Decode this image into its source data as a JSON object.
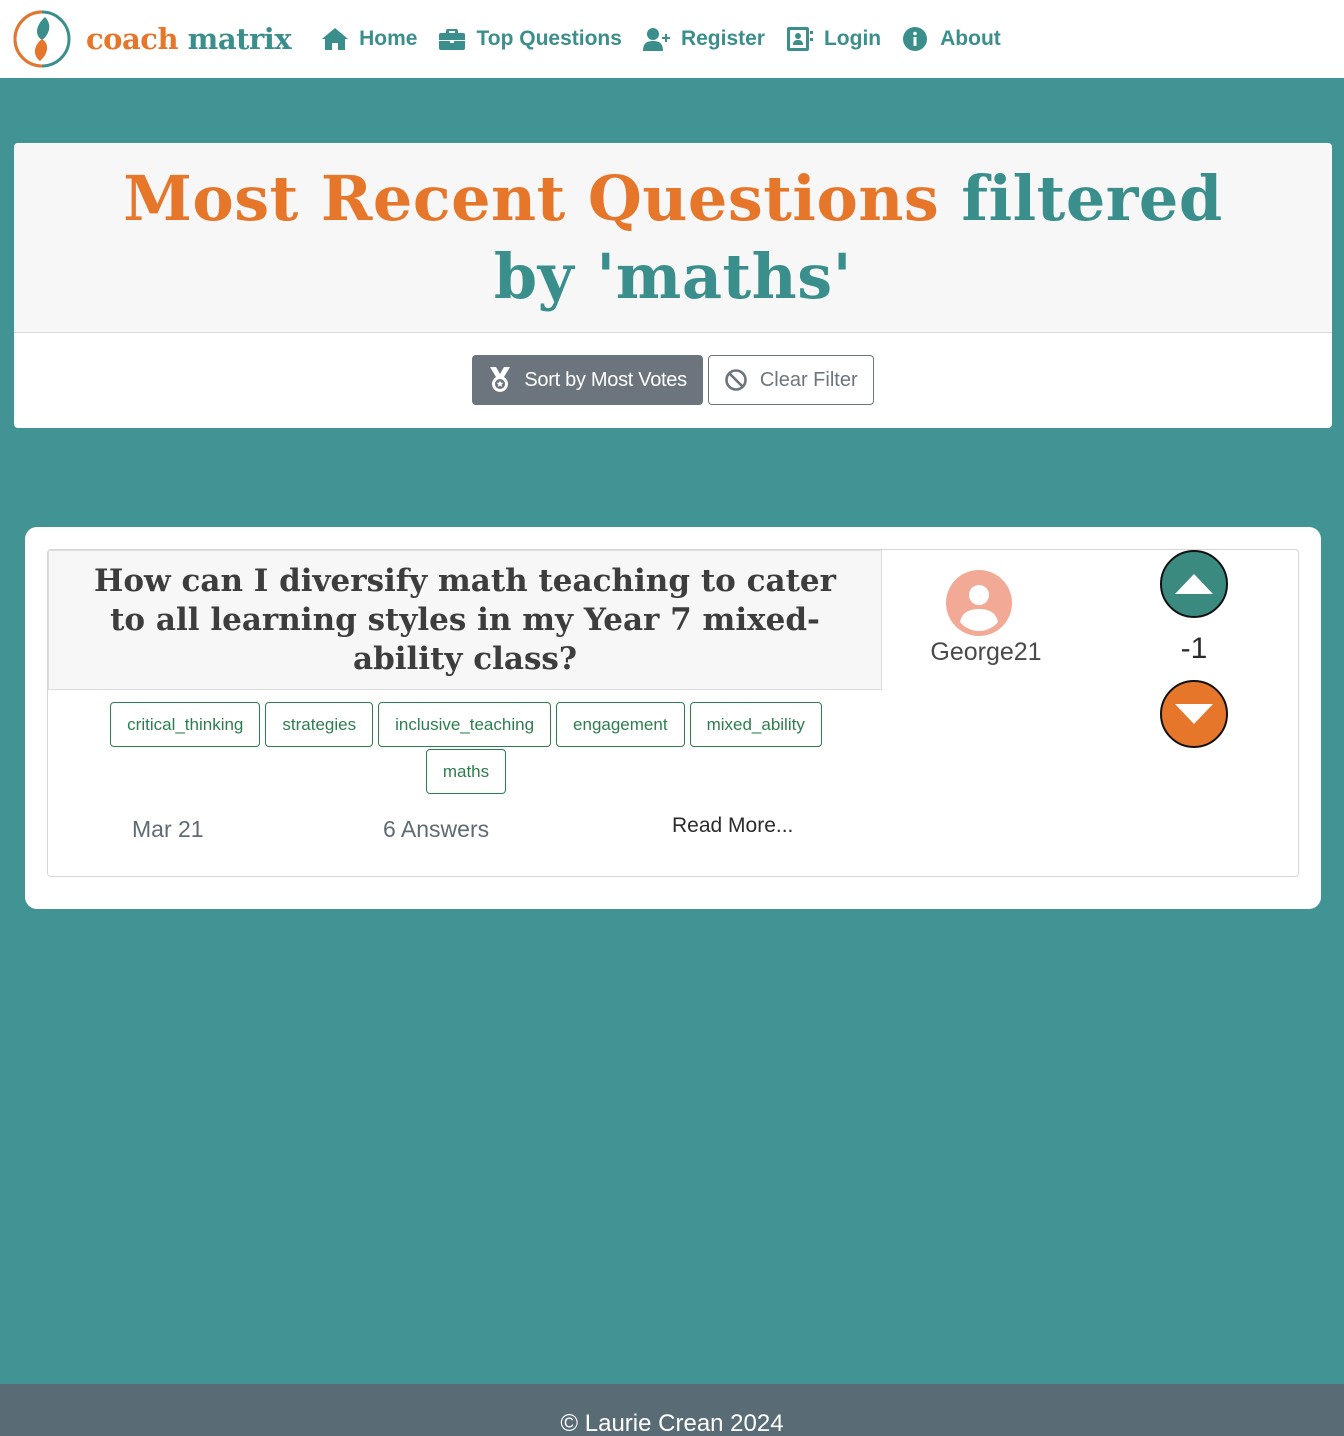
{
  "brand": {
    "part1": "coach",
    "part2": "matrix"
  },
  "nav": {
    "home": "Home",
    "top_questions": "Top Questions",
    "register": "Register",
    "login": "Login",
    "about": "About"
  },
  "header": {
    "title_highlight": "Most Recent Questions",
    "title_rest": "filtered by 'maths'",
    "sort_button": "Sort by Most Votes",
    "clear_button": "Clear Filter"
  },
  "question": {
    "title": "How can I diversify math teaching to cater to all learning styles in my Year 7 mixed-ability class?",
    "tags": [
      "critical_thinking",
      "strategies",
      "inclusive_teaching",
      "engagement",
      "mixed_ability",
      "maths"
    ],
    "date": "Mar 21",
    "answers": "6 Answers",
    "read_more": "Read More...",
    "author": "George21",
    "votes": "-1"
  },
  "footer": {
    "text": "© Laurie Crean 2024"
  },
  "colors": {
    "teal": "#429494",
    "orange": "#e5762a",
    "brand_teal": "#3a8f8c",
    "footer": "#596b75"
  },
  "icons": [
    "home-icon",
    "briefcase-icon",
    "user-plus-icon",
    "contact-book-icon",
    "info-icon",
    "medal-icon",
    "ban-icon",
    "user-avatar-icon",
    "caret-up-icon",
    "caret-down-icon"
  ]
}
